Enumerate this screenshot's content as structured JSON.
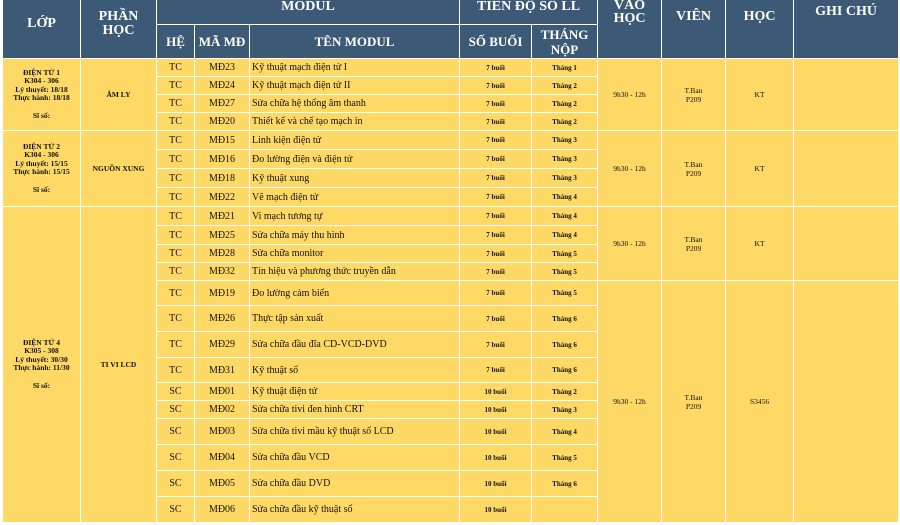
{
  "header": {
    "lop": "LỚP",
    "phan_hoc": "PHẦN HỌC",
    "modul": "MODUL",
    "tien_do": "TIẾN ĐỘ SỔ LL",
    "vao_hoc": "VÀO HỌC",
    "giao_vien": "VIÊN",
    "phong_hoc": "HỌC",
    "ghi_chu": "GHI CHÚ",
    "he": "HỆ",
    "ma_md": "MÃ MĐ",
    "ten_modul": "TÊN MODUL",
    "so_buoi": "SỐ BUỔI",
    "thang_nop": "THÁNG NỘP"
  },
  "groups": [
    {
      "lop_name": "ĐIỆN TỬ 1",
      "lop_room": "K304 - 306",
      "ly_thuyet": "Lý thuyết: 18/18",
      "thuc_hanh": "Thực hành: 18/18",
      "si_so": "Sĩ số:",
      "phan_hoc": "ÂM LY",
      "vao_hoc": "9h30 - 12h",
      "gv_name": "T.Ban",
      "gv_room": "P209",
      "phong": "KT",
      "rows": [
        {
          "he": "TC",
          "ma": "MĐ23",
          "ten": "Kỹ thuật mạch điện tử I",
          "so_buoi": "7 buổi",
          "thang": "Tháng 1"
        },
        {
          "he": "TC",
          "ma": "MĐ24",
          "ten": "Kỹ thuật mạch điện tử II",
          "so_buoi": "7 buổi",
          "thang": "Tháng 2"
        },
        {
          "he": "TC",
          "ma": "MĐ27",
          "ten": "Sửa chữa hệ thống âm thanh",
          "so_buoi": "7 buổi",
          "thang": "Tháng 2"
        },
        {
          "he": "TC",
          "ma": "MĐ20",
          "ten": "Thiết kế và chế tạo mạch in",
          "so_buoi": "7 buổi",
          "thang": "Tháng 2"
        }
      ]
    },
    {
      "lop_name": "ĐIỆN TỬ 2",
      "lop_room": "K304 - 306",
      "ly_thuyet": "Lý thuyết: 15/15",
      "thuc_hanh": "Thực hành: 15/15",
      "si_so": "Sĩ số:",
      "phan_hoc": "NGUỒN XUNG",
      "vao_hoc": "9h30 - 12h",
      "gv_name": "T.Ban",
      "gv_room": "P209",
      "phong": "KT",
      "rows": [
        {
          "he": "TC",
          "ma": "MĐ15",
          "ten": "Linh kiện điện tử",
          "so_buoi": "7 buổi",
          "thang": "Tháng 3"
        },
        {
          "he": "TC",
          "ma": "MĐ16",
          "ten": "Đo lường điện và điện tử",
          "so_buoi": "7 buổi",
          "thang": "Tháng 3"
        },
        {
          "he": "TC",
          "ma": "MĐ18",
          "ten": "Kỹ thuật xung",
          "so_buoi": "7 buổi",
          "thang": "Tháng 3"
        },
        {
          "he": "TC",
          "ma": "MĐ22",
          "ten": "Vẽ mạch điện tử",
          "so_buoi": "7 buổi",
          "thang": "Tháng 4"
        }
      ]
    },
    {
      "lop_name": "ĐIỆN TỬ 4",
      "lop_room": "K305 - 308",
      "ly_thuyet": "Lý thuyết: 30/30",
      "thuc_hanh": "Thực hành: 11/30",
      "si_so": "Sĩ số:",
      "phan_hoc": "TI VI LCD",
      "sub_a": {
        "vao_hoc": "9h30 - 12h",
        "gv_name": "T.Ban",
        "gv_room": "P209",
        "phong": "KT"
      },
      "sub_b": {
        "vao_hoc": "9h30 - 12h",
        "gv_name": "T.Ban",
        "gv_room": "P209",
        "phong": "S3456"
      },
      "rows": [
        {
          "he": "TC",
          "ma": "MĐ21",
          "ten": "Vi mạch tương tự",
          "so_buoi": "7 buổi",
          "thang": "Tháng 4"
        },
        {
          "he": "TC",
          "ma": "MĐ25",
          "ten": "Sửa chữa máy thu hình",
          "so_buoi": "7 buổi",
          "thang": "Tháng 4"
        },
        {
          "he": "TC",
          "ma": "MĐ28",
          "ten": "Sửa chữa monitor",
          "so_buoi": "7 buổi",
          "thang": "Tháng 5"
        },
        {
          "he": "TC",
          "ma": "MĐ32",
          "ten": "Tín hiệu và phương thức truyền dẫn",
          "so_buoi": "7 buổi",
          "thang": "Tháng 5"
        },
        {
          "he": "TC",
          "ma": "MĐ19",
          "ten": "Đo lường cảm biến",
          "so_buoi": "7 buổi",
          "thang": "Tháng 5"
        },
        {
          "he": "TC",
          "ma": "MĐ26",
          "ten": "Thực tập sản xuất",
          "so_buoi": "7 buổi",
          "thang": "Tháng 6"
        },
        {
          "he": "TC",
          "ma": "MĐ29",
          "ten": "Sửa chữa đầu đĩa CD-VCD-DVD",
          "so_buoi": "7 buổi",
          "thang": "Tháng 6"
        },
        {
          "he": "TC",
          "ma": "MĐ31",
          "ten": "Kỹ thuật số",
          "so_buoi": "7 buổi",
          "thang": "Tháng 6"
        },
        {
          "he": "SC",
          "ma": "MĐ01",
          "ten": "Kỹ thuật điện tử",
          "so_buoi": "10 buổi",
          "thang": "Tháng 2"
        },
        {
          "he": "SC",
          "ma": "MĐ02",
          "ten": "Sửa chữa tivi đen hình CRT",
          "so_buoi": "10 buổi",
          "thang": "Tháng 3"
        },
        {
          "he": "SC",
          "ma": "MĐ03",
          "ten": "Sửa chữa tivi mầu kỹ thuật số LCD",
          "so_buoi": "10 buổi",
          "thang": "Tháng 4"
        },
        {
          "he": "SC",
          "ma": "MĐ04",
          "ten": "Sửa chữa đầu VCD",
          "so_buoi": "10 buổi",
          "thang": "Tháng 5"
        },
        {
          "he": "SC",
          "ma": "MĐ05",
          "ten": "Sửa chữa đầu DVD",
          "so_buoi": "10 buổi",
          "thang": "Tháng 6"
        },
        {
          "he": "SC",
          "ma": "MĐ06",
          "ten": "Sửa chữa đầu kỹ thuật số",
          "so_buoi": "10 buổi",
          "thang": ""
        }
      ]
    }
  ]
}
